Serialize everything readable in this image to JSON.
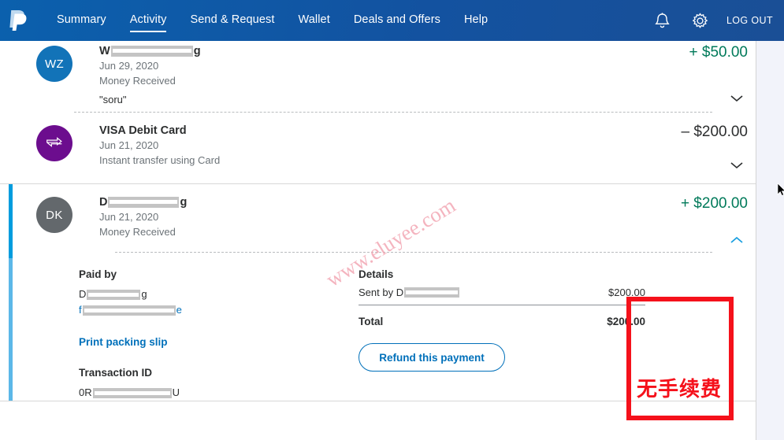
{
  "nav": {
    "logo": "paypal-logo",
    "links": [
      {
        "label": "Summary",
        "active": false
      },
      {
        "label": "Activity",
        "active": true
      },
      {
        "label": "Send & Request",
        "active": false
      },
      {
        "label": "Wallet",
        "active": false
      },
      {
        "label": "Deals and Offers",
        "active": false
      },
      {
        "label": "Help",
        "active": false
      }
    ],
    "bell_icon": "bell-icon",
    "gear_icon": "gear-icon",
    "logout_label": "LOG OUT"
  },
  "transactions": [
    {
      "avatar_initials": "WZ",
      "avatar_color": "#1273b8",
      "name_prefix": "W",
      "name_suffix": "g",
      "date": "Jun 29, 2020",
      "type": "Money Received",
      "note": "\"soru\"",
      "amount": "+ $50.00",
      "amount_sign": "positive",
      "expanded": false,
      "chevron": "chevron-down-icon"
    },
    {
      "avatar_initials": "",
      "avatar_color": "#6c0d8e",
      "name_prefix": "VISA Debit Card",
      "name_suffix": "",
      "date": "Jun 21, 2020",
      "type": "Instant transfer using Card",
      "note": "",
      "amount": "– $200.00",
      "amount_sign": "negative",
      "expanded": false,
      "chevron": "chevron-down-icon"
    },
    {
      "avatar_initials": "DK",
      "avatar_color": "#63686c",
      "name_prefix": "D",
      "name_suffix": "g",
      "date": "Jun 21, 2020",
      "type": "Money Received",
      "note": "",
      "amount": "+ $200.00",
      "amount_sign": "positive",
      "expanded": true,
      "chevron": "chevron-up-icon"
    }
  ],
  "detail": {
    "paid_by_heading": "Paid by",
    "paid_by_name_prefix": "D",
    "paid_by_name_suffix": "g",
    "paid_by_email_prefix": "f",
    "paid_by_email_suffix": "e",
    "print_packing_slip": "Print packing slip",
    "transaction_id_heading": "Transaction ID",
    "transaction_id_prefix": "0R",
    "transaction_id_suffix": "U",
    "details_heading": "Details",
    "sent_by_label": "Sent by",
    "sent_by_name_prefix": "D",
    "sent_by_amount": "$200.00",
    "total_label": "Total",
    "total_amount": "$200.00",
    "refund_button": "Refund this payment"
  },
  "annotation": {
    "text": "无手续费",
    "color": "#f5111b"
  },
  "watermark": {
    "text": "www.eluyee.com",
    "color": "#f3a8b4"
  },
  "colors": {
    "nav_blue": "#13549c",
    "link_blue": "#0070ba",
    "positive_green": "#017a5a",
    "accent_top": "#009cde",
    "accent_bottom": "#5cb8e8",
    "page_bg": "#f2f3fa"
  }
}
